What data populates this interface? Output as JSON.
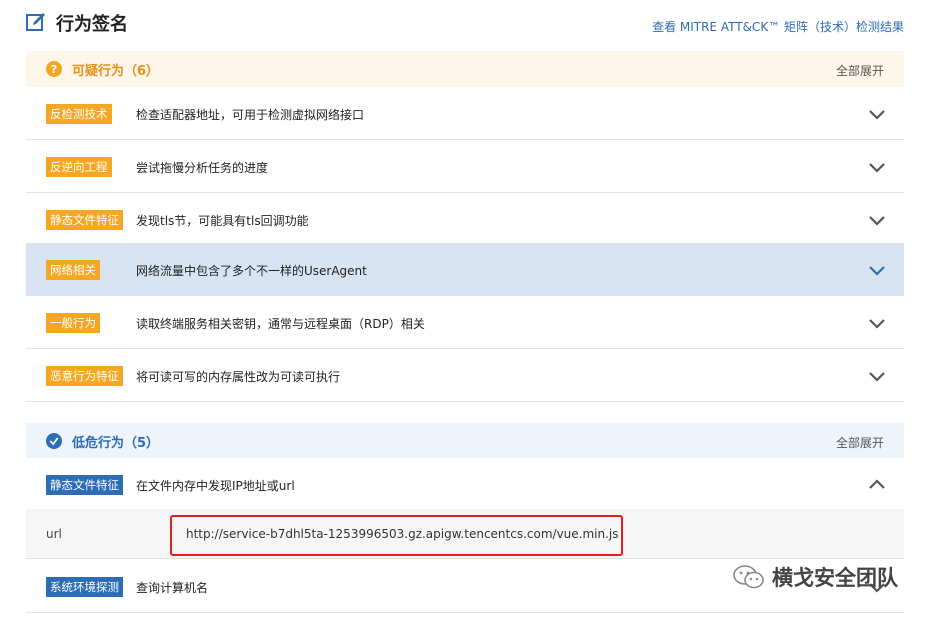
{
  "header": {
    "title": "行为签名",
    "mitre_link": "查看 MITRE ATT&CK™ 矩阵（技术）检测结果"
  },
  "sections": {
    "suspicious": {
      "title": "可疑行为（6）",
      "expand_all": "全部展开",
      "icon": "question-icon",
      "color": "#f5a623"
    },
    "low": {
      "title": "低危行为（5）",
      "expand_all": "全部展开",
      "icon": "check-circle-icon",
      "color": "#2d6db5"
    }
  },
  "rows": [
    {
      "tag": "反检测技术",
      "desc": "检查适配器地址，可用于检测虚拟网络接口"
    },
    {
      "tag": "反逆向工程",
      "desc": "尝试拖慢分析任务的进度"
    },
    {
      "tag": "静态文件特征",
      "desc": "发现tls节，可能具有tls回调功能"
    },
    {
      "tag": "网络相关",
      "desc": "网络流量中包含了多个不一样的UserAgent"
    },
    {
      "tag": "一般行为",
      "desc": "读取终端服务相关密钥，通常与远程桌面（RDP）相关"
    },
    {
      "tag": "恶意行为特征",
      "desc": "将可读可写的内存属性改为可读可执行"
    },
    {
      "tag": "静态文件特征",
      "desc": "在文件内存中发现IP地址或url"
    },
    {
      "tag": "系统环境探测",
      "desc": "查询计算机名"
    }
  ],
  "detail": {
    "key": "url",
    "value": "http://service-b7dhl5ta-1253996503.gz.apigw.tencentcs.com/vue.min.js"
  },
  "watermark": {
    "text": "横戈安全团队"
  },
  "colors": {
    "accent_blue": "#2d6db5",
    "accent_orange": "#f5a623",
    "highlight_row": "#d8e4f3",
    "red_box": "#e02020"
  }
}
